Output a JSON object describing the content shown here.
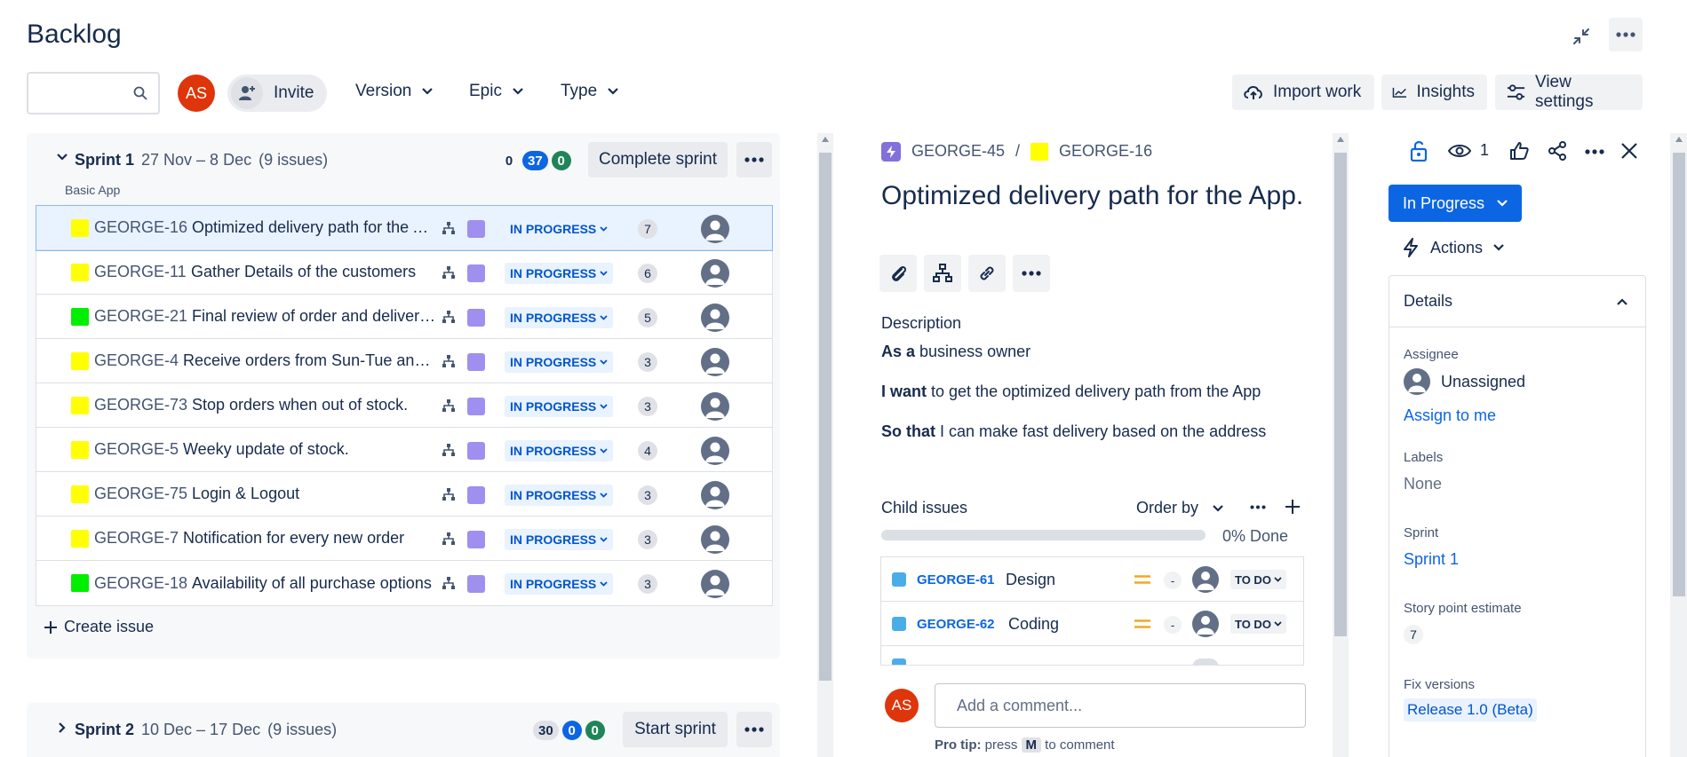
{
  "header": {
    "title": "Backlog",
    "minimize_icon": "minimize-icon",
    "more_icon": "more-icon"
  },
  "toolbar": {
    "search": {
      "value": "",
      "placeholder": ""
    },
    "avatar_initials": "AS",
    "invite_label": "Invite",
    "filters": [
      "Version",
      "Epic",
      "Type"
    ],
    "import_label": "Import work",
    "insights_label": "Insights",
    "view_settings_label": "View settings"
  },
  "sprint1": {
    "name": "Sprint 1",
    "dates": "27 Nov – 8 Dec",
    "count": "(9 issues)",
    "goal": "Basic App",
    "badge_todo": "0",
    "badge_inprogress": "37",
    "badge_done": "0",
    "action_label": "Complete sprint",
    "issues": [
      {
        "key": "GEORGE-16",
        "summary": "Optimized delivery path for the App.",
        "color": "#ffff00",
        "status": "IN PROGRESS",
        "points": "7",
        "selected": true
      },
      {
        "key": "GEORGE-11",
        "summary": "Gather Details of the customers",
        "color": "#ffff00",
        "status": "IN PROGRESS",
        "points": "6"
      },
      {
        "key": "GEORGE-21",
        "summary": "Final review of order and delivery ...",
        "color": "#00ee00",
        "status": "IN PROGRESS",
        "points": "5"
      },
      {
        "key": "GEORGE-4",
        "summary": "Receive orders from Sun-Tue and T...",
        "color": "#ffff00",
        "status": "IN PROGRESS",
        "points": "3"
      },
      {
        "key": "GEORGE-73",
        "summary": "Stop orders when out of stock.",
        "color": "#ffff00",
        "status": "IN PROGRESS",
        "points": "3"
      },
      {
        "key": "GEORGE-5",
        "summary": "Weeky update of stock.",
        "color": "#ffff00",
        "status": "IN PROGRESS",
        "points": "4"
      },
      {
        "key": "GEORGE-75",
        "summary": "Login & Logout",
        "color": "#ffff00",
        "status": "IN PROGRESS",
        "points": "3"
      },
      {
        "key": "GEORGE-7",
        "summary": "Notification for every new order",
        "color": "#ffff00",
        "status": "IN PROGRESS",
        "points": "3"
      },
      {
        "key": "GEORGE-18",
        "summary": "Availability of all purchase options",
        "color": "#00ee00",
        "status": "IN PROGRESS",
        "points": "3"
      }
    ],
    "create_label": "Create issue"
  },
  "sprint2": {
    "name": "Sprint 2",
    "dates": "10 Dec – 17 Dec",
    "count": "(9 issues)",
    "badge_todo": "30",
    "badge_inprogress": "0",
    "badge_done": "0",
    "action_label": "Start sprint"
  },
  "detail": {
    "parent_key": "GEORGE-45",
    "separator": "/",
    "issue_key": "GEORGE-16",
    "title": "Optimized delivery path for the App.",
    "description_label": "Description",
    "desc_lines": [
      {
        "bold": "As a",
        "text": " business owner"
      },
      {
        "bold": "I want",
        "text": " to get the optimized delivery path from the App"
      },
      {
        "bold": "So that",
        "text": " I can make fast delivery based on the address"
      }
    ],
    "child_issues_label": "Child issues",
    "order_by_label": "Order by",
    "progress_fraction": 0,
    "progress_label": "0% Done",
    "children": [
      {
        "key": "GEORGE-61",
        "summary": "Design",
        "dash": "-",
        "status": "TO DO"
      },
      {
        "key": "GEORGE-62",
        "summary": "Coding",
        "dash": "-",
        "status": "TO DO"
      }
    ],
    "comment_avatar": "AS",
    "comment_placeholder": "Add a comment...",
    "pro_tip_bold": "Pro tip:",
    "pro_tip_text": " press ",
    "pro_tip_key": "M",
    "pro_tip_end": " to comment"
  },
  "sidebar": {
    "watch_count": "1",
    "status_button": "In Progress",
    "actions_label": "Actions",
    "details_label": "Details",
    "assignee_label": "Assignee",
    "assignee_value": "Unassigned",
    "assign_to_me": "Assign to me",
    "labels_label": "Labels",
    "labels_value": "None",
    "sprint_label": "Sprint",
    "sprint_value": "Sprint 1",
    "story_points_label": "Story point estimate",
    "story_points_value": "7",
    "fix_versions_label": "Fix versions",
    "fix_versions_value": "Release 1.0 (Beta)"
  }
}
